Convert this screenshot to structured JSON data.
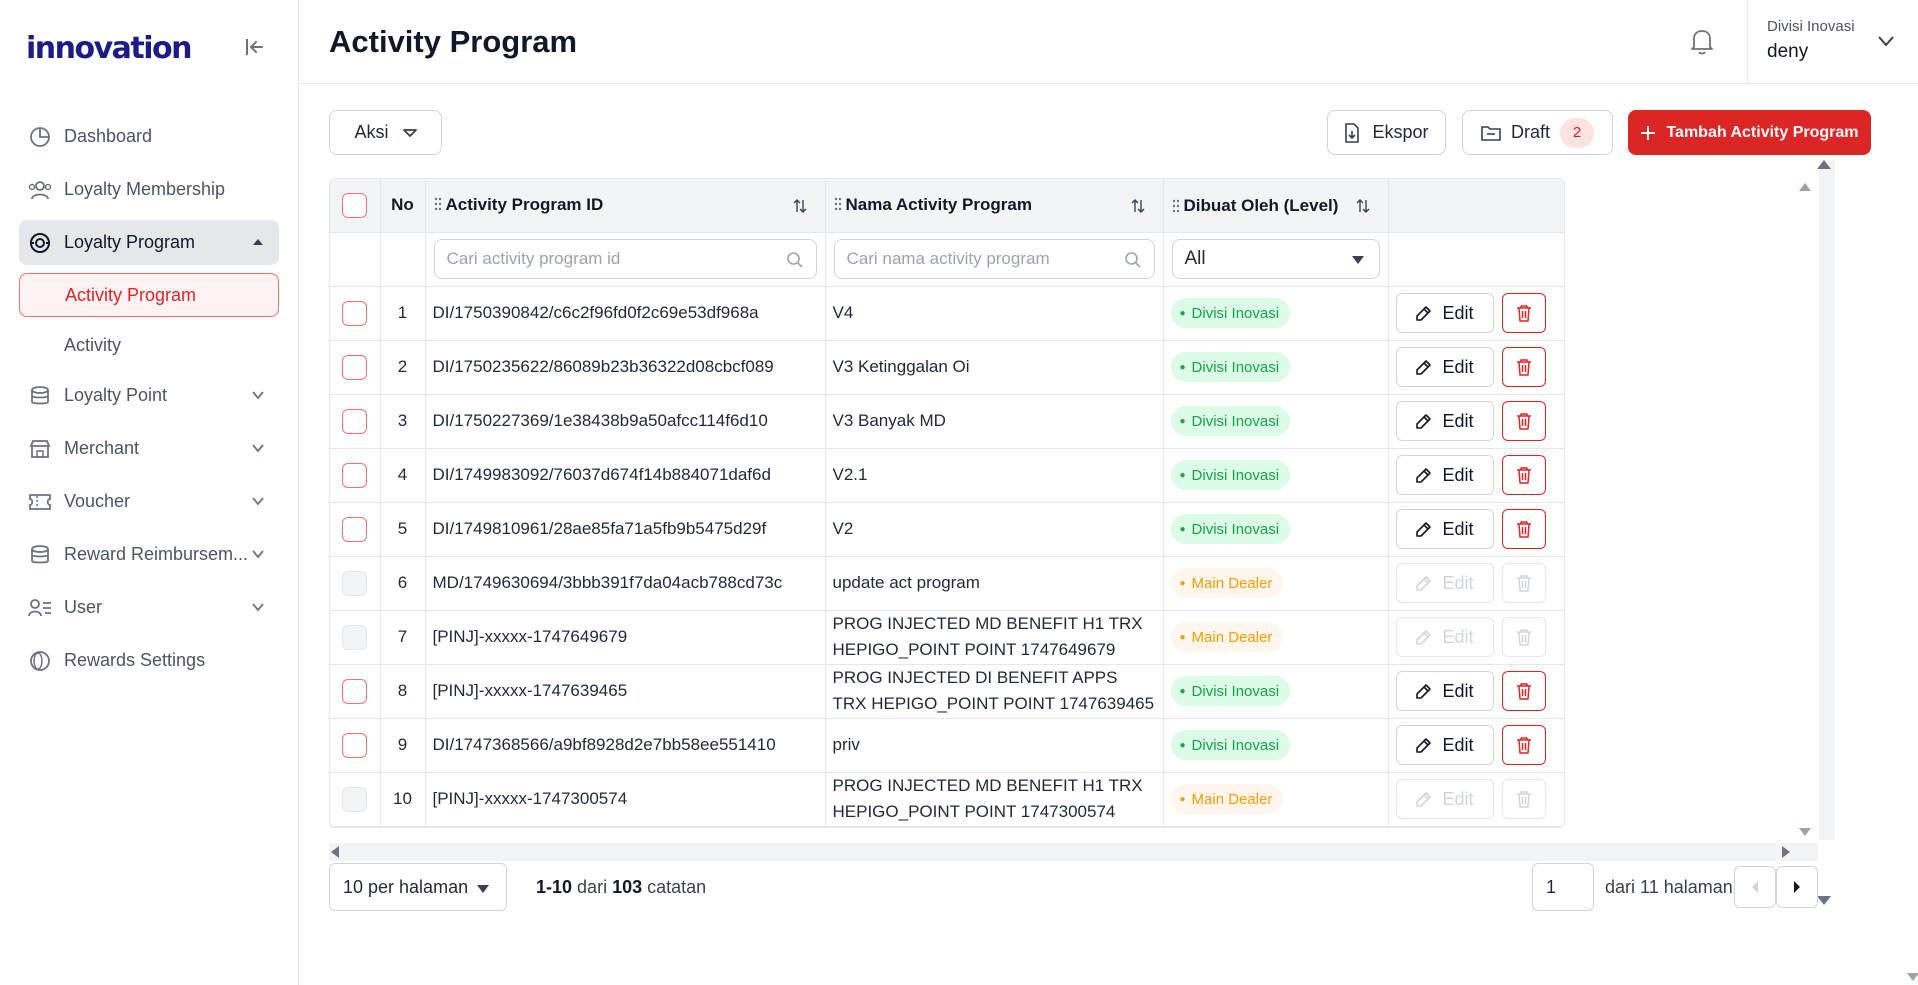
{
  "app": {
    "logo_text": "innovation"
  },
  "sidebar": {
    "items": [
      {
        "label": "Dashboard",
        "icon": "dashboard-icon"
      },
      {
        "label": "Loyalty Membership",
        "icon": "users-icon"
      },
      {
        "label": "Loyalty Program",
        "icon": "program-icon",
        "expanded": true
      },
      {
        "label": "Loyalty Point",
        "icon": "coins-icon"
      },
      {
        "label": "Merchant",
        "icon": "store-icon"
      },
      {
        "label": "Voucher",
        "icon": "ticket-icon"
      },
      {
        "label": "Reward Reimbursem...",
        "icon": "database-icon"
      },
      {
        "label": "User",
        "icon": "user-list-icon"
      },
      {
        "label": "Rewards Settings",
        "icon": "rewards-icon"
      }
    ],
    "subitems": [
      {
        "label": "Activity Program",
        "active": true
      },
      {
        "label": "Activity",
        "active": false
      }
    ]
  },
  "header": {
    "title": "Activity Program",
    "org": "Divisi Inovasi",
    "user": "deny"
  },
  "toolbar": {
    "aksi_label": "Aksi",
    "export_label": "Ekspor",
    "draft_label": "Draft",
    "draft_count": "2",
    "add_label": "Tambah Activity Program"
  },
  "table": {
    "headers": {
      "no": "No",
      "id": "Activity Program ID",
      "name": "Nama Activity Program",
      "created_by": "Dibuat Oleh (Level)"
    },
    "filters": {
      "id_placeholder": "Cari activity program id",
      "name_placeholder": "Cari nama activity program",
      "level_value": "All"
    },
    "edit_label": "Edit",
    "rows": [
      {
        "no": "1",
        "id": "DI/1750390842/c6c2f96fd0f2c69e53df968a",
        "name": "V4",
        "level": "Divisi Inovasi",
        "editable": true
      },
      {
        "no": "2",
        "id": "DI/1750235622/86089b23b36322d08cbcf089",
        "name": "V3 Ketinggalan Oi",
        "level": "Divisi Inovasi",
        "editable": true
      },
      {
        "no": "3",
        "id": "DI/1750227369/1e38438b9a50afcc114f6d10",
        "name": "V3 Banyak MD",
        "level": "Divisi Inovasi",
        "editable": true
      },
      {
        "no": "4",
        "id": "DI/1749983092/76037d674f14b884071daf6d",
        "name": "V2.1",
        "level": "Divisi Inovasi",
        "editable": true
      },
      {
        "no": "5",
        "id": "DI/1749810961/28ae85fa71a5fb9b5475d29f",
        "name": "V2",
        "level": "Divisi Inovasi",
        "editable": true
      },
      {
        "no": "6",
        "id": "MD/1749630694/3bbb391f7da04acb788cd73c",
        "name": "update act program",
        "level": "Main Dealer",
        "editable": false
      },
      {
        "no": "7",
        "id": "[PINJ]-xxxxx-1747649679",
        "name": "PROG INJECTED MD BENEFIT H1 TRX HEPIGO_POINT POINT 1747649679",
        "level": "Main Dealer",
        "editable": false
      },
      {
        "no": "8",
        "id": "[PINJ]-xxxxx-1747639465",
        "name": "PROG INJECTED DI BENEFIT APPS TRX HEPIGO_POINT POINT 1747639465",
        "level": "Divisi Inovasi",
        "editable": true
      },
      {
        "no": "9",
        "id": "DI/1747368566/a9bf8928d2e7bb58ee551410",
        "name": "priv",
        "level": "Divisi Inovasi",
        "editable": true
      },
      {
        "no": "10",
        "id": "[PINJ]-xxxxx-1747300574",
        "name": "PROG INJECTED MD BENEFIT H1 TRX HEPIGO_POINT POINT 1747300574",
        "level": "Main Dealer",
        "editable": false
      }
    ]
  },
  "pagination": {
    "per_page_label": "10 per halaman",
    "range": "1-10",
    "dari": "dari",
    "total": "103",
    "catatan": "catatan",
    "current_page": "1",
    "pages_label": "dari 11 halaman"
  },
  "colors": {
    "accent": "#dc2626",
    "brand": "#1d1a8a",
    "green": "#16a34a",
    "orange": "#f59e0b"
  }
}
